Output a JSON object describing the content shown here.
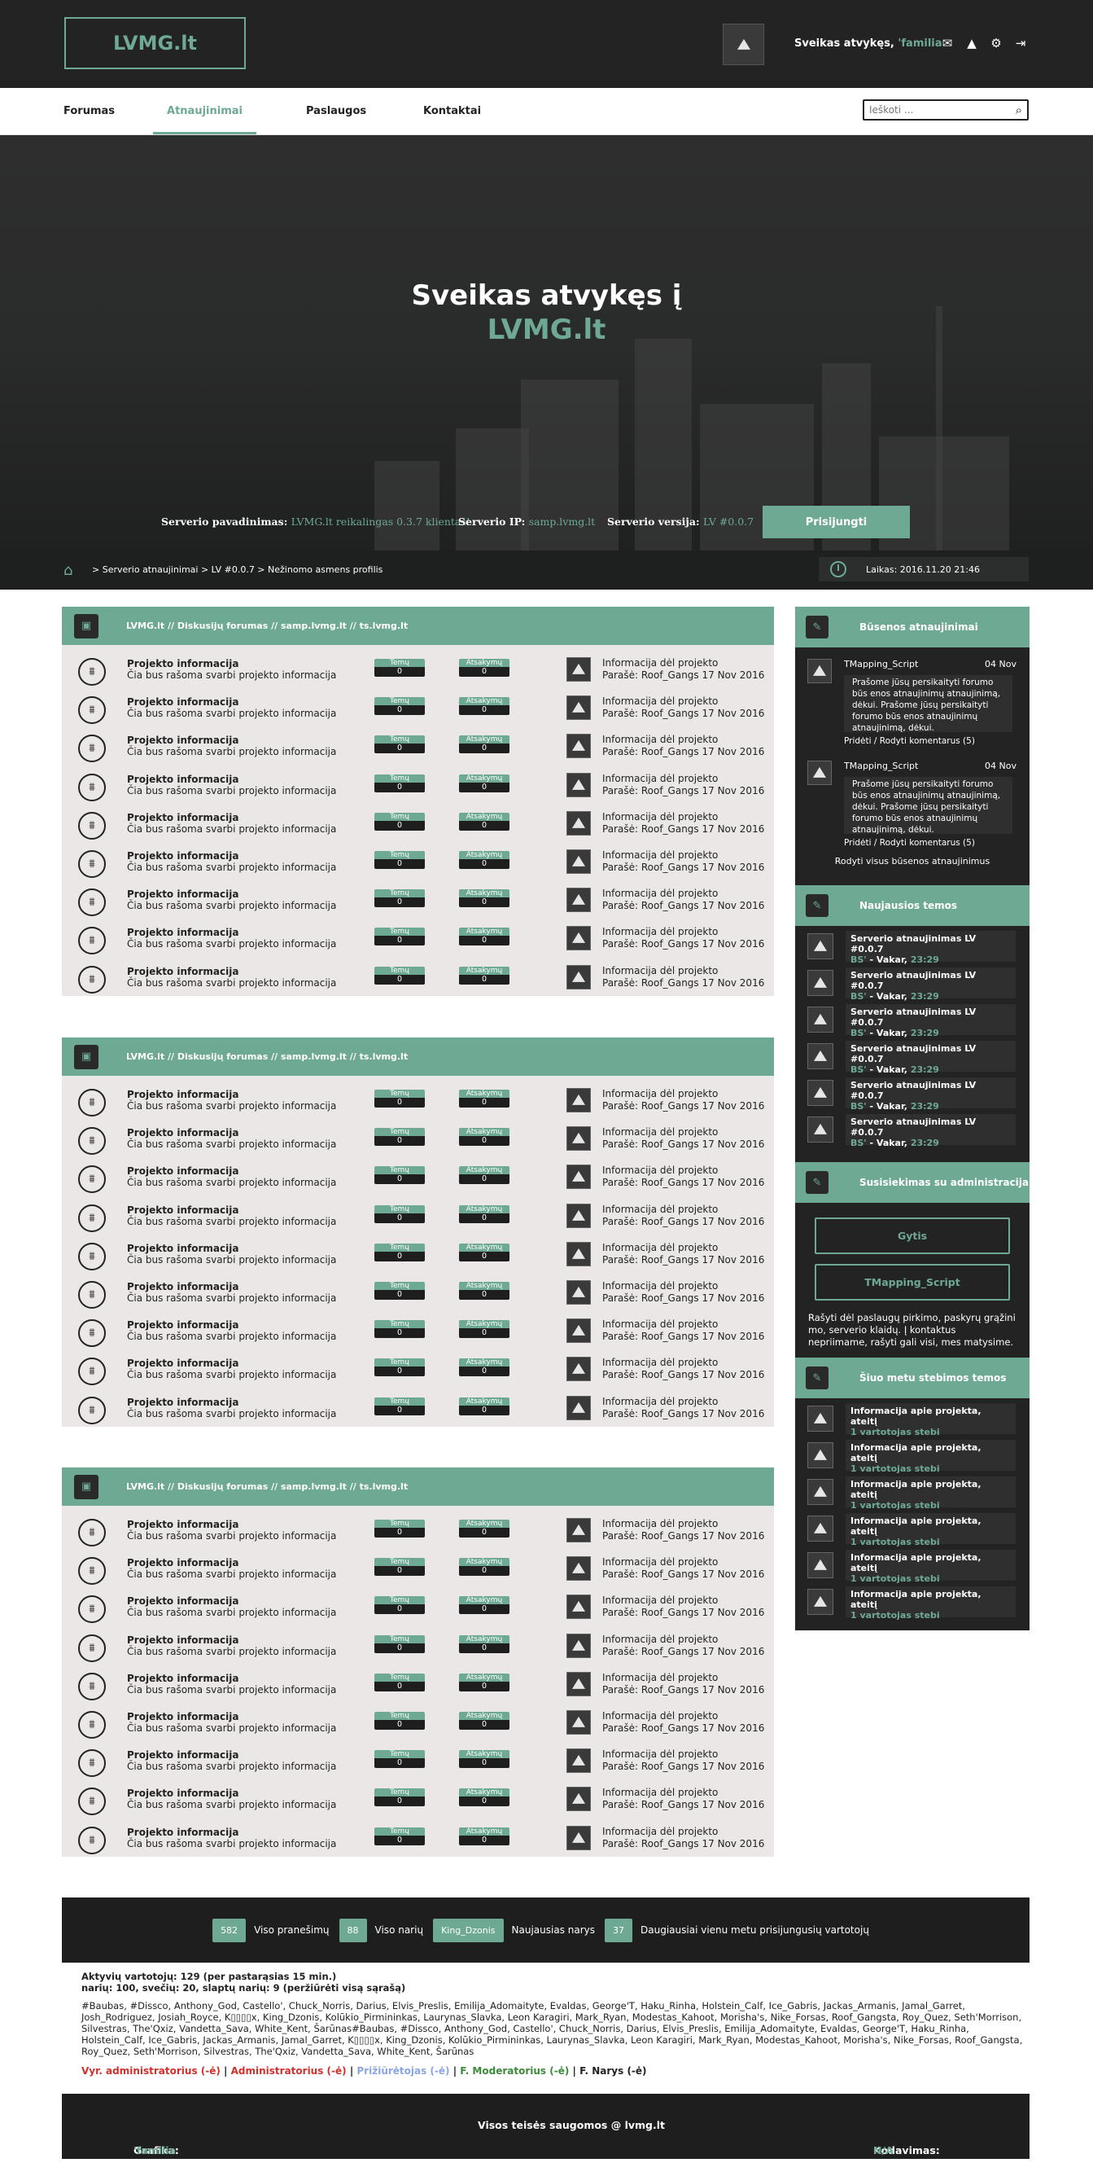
{
  "header": {
    "logo": "LVMG.lt",
    "welcome_prefix": "Sveikas atvykęs, ",
    "welcome_user": "'familia",
    "icons": [
      "envelope-icon",
      "alert-icon",
      "gear-icon",
      "logout-icon"
    ]
  },
  "nav": {
    "items": [
      "Forumas",
      "Atnaujinimai",
      "Paslaugos",
      "Kontaktai"
    ],
    "active": "Atnaujinimai",
    "search_placeholder": "Ieškoti ..."
  },
  "hero": {
    "title_line1": "Sveikas atvykęs į",
    "title_line2": "LVMG.lt"
  },
  "server": {
    "name_label": "Serverio pavadinimas:",
    "name_value": "LVMG.lt reikalingas 0.3.7 klientas!",
    "ip_label": "Serverio IP:",
    "ip_value": "samp.lvmg.lt",
    "version_label": "Serverio versija:",
    "version_value": "LV #0.0.7",
    "connect": "Prisijungti"
  },
  "breadcrumb": {
    "path": "> Serverio atnaujinimai > LV #0.0.7 > Nežinomo asmens profilis",
    "time": "Laikas: 2016.11.20 21:46"
  },
  "forum": {
    "title": "LVMG.lt // Diskusijų forumas // samp.lvmg.lt // ts.lvmg.lt",
    "row_title": "Projekto informacija",
    "row_desc": "Čia bus rašoma svarbi projekto informacija",
    "topics_label": "Temų",
    "topics_value": "0",
    "replies_label": "Atsakymų",
    "replies_value": "0",
    "last_title": "Informacija dėl projekto",
    "last_by": "Parašė: Roof_Gangs 17 Nov 2016"
  },
  "sidebar": {
    "status": {
      "title": "Būsenos atnaujinimai",
      "items": [
        {
          "name": "TMapping_Script",
          "date": "04 Nov",
          "text": "Prašome jūsų persikaityti forumo būs enos atnaujinimų atnaujinimą, dėkui. Prašome jūsų persikaityti forumo būs enos atnaujinimų atnaujinimą, dėkui.",
          "link": "Pridėti / Rodyti komentarus (5)"
        },
        {
          "name": "TMapping_Script",
          "date": "04 Nov",
          "text": "Prašome jūsų persikaityti forumo būs enos atnaujinimų atnaujinimą, dėkui. Prašome jūsų persikaityti forumo būs enos atnaujinimų atnaujinimą, dėkui.",
          "link": "Pridėti / Rodyti komentarus (5)"
        }
      ],
      "show_all": "Rodyti visus būsenos atnaujinimus"
    },
    "new_topics": {
      "title": "Naujausios temos",
      "topic_title": "Serverio atnaujinimas LV #0.0.7",
      "topic_author": "BS'",
      "topic_when": " - Vakar, ",
      "topic_time": "23:29"
    },
    "contact": {
      "title": "Susisiekimas su administracija",
      "buttons": [
        "Gytis",
        "TMapping_Script"
      ],
      "note": "Rašyti dėl paslaugų pirkimo, paskyrų grąžini mo, serverio klaidų. Į kontaktus nepriimame, rašyti gali visi, mes matysime."
    },
    "watching": {
      "title": "Šiuo metu stebimos temos",
      "topic_title": "Informacija apie projekta, ateitį",
      "topic_sub": "1 vartotojas stebi"
    }
  },
  "stats": [
    {
      "value": "582",
      "label": "Viso pranešimų"
    },
    {
      "value": "88",
      "label": "Viso narių"
    },
    {
      "value": "King_Dzonis",
      "label": "Naujausias narys"
    },
    {
      "value": "37",
      "label": "Daugiausiai vienu metu prisijungusių vartotojų"
    }
  ],
  "online": {
    "line1": "Aktyvių vartotojų: 129 (per pastarąsias 15 min.)",
    "line2": "narių: 100, svečių: 20, slaptų narių: 9   (peržiūrėti visą sąrašą)",
    "names": "#Baubas, #Dissco, Anthony_God, Castello', Chuck_Norris, Darius, Elvis_Preslis, Emilija_Adomaityte, Evaldas, George'T, Haku_Rinha, Holstein_Calf, Ice_Gabris, Jackas_Armanis, Jamal_Garret, Josh_Rodriguez, Josiah_Royce, K▯▯▯▯x, King_Dzonis, Kolūkio_Pirmininkas, Laurynas_Slavka, Leon Karagiri, Mark_Ryan, Modestas_Kahoot, Morisha's, Nike_Forsas, Roof_Gangsta, Roy_Quez, Seth'Morrison, Silvestras, The'Qxiz, Vandetta_Sava, White_Kent, Šarūnas#Baubas, #Dissco, Anthony_God, Castello', Chuck_Norris, Darius, Elvis_Preslis, Emilija_Adomaityte, Evaldas, George'T, Haku_Rinha, Holstein_Calf, Ice_Gabris, Jackas_Armanis, Jamal_Garret, K▯▯▯▯x, King_Dzonis, Kolūkio_Pirmininkas, Laurynas_Slavka, Leon Karagiri, Mark_Ryan, Modestas_Kahoot, Morisha's, Nike_Forsas, Roof_Gangsta, Roy_Quez, Seth'Morrison, Silvestras, The'Qxiz, Vandetta_Sava, White_Kent, Šarūnas",
    "legend": [
      {
        "text": "Vyr. administratorius (-ė)",
        "color": "#d0312d"
      },
      {
        "text": "Administratorius (-ė)",
        "color": "#d0312d"
      },
      {
        "text": "Prižiūrėtojas (-ė)",
        "color": "#8aa6e0"
      },
      {
        "text": "F. Moderatorius (-ė)",
        "color": "#3c8a3c"
      },
      {
        "text": "F. Narys (-ė)",
        "color": "#222222"
      }
    ]
  },
  "footer": {
    "design_label": "Grafika: ",
    "design_value": "'familia",
    "rights": "Visos teisės saugomos @ lvmg.lt",
    "code_label": "Kodavimas: ",
    "code_value": "N/A"
  },
  "colors": {
    "accent": "#6ea993",
    "dark": "#232323",
    "panel": "#ebe7e6"
  }
}
